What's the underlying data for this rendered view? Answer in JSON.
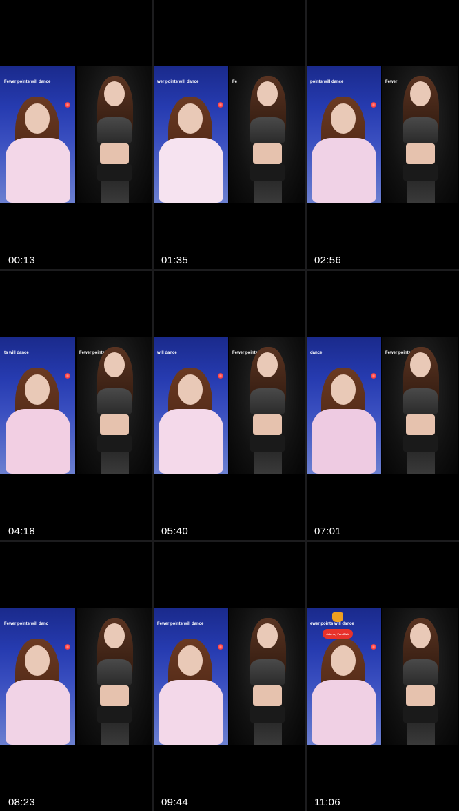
{
  "grid": {
    "thumbnails": [
      {
        "timestamp": "00:13",
        "caption": "Fewer points will dance",
        "caption2": ""
      },
      {
        "timestamp": "01:35",
        "caption": "wer points will dance",
        "caption2": "Fe"
      },
      {
        "timestamp": "02:56",
        "caption": "points will dance",
        "caption2": "Fewer"
      },
      {
        "timestamp": "04:18",
        "caption": "ts will dance",
        "caption2": "Fewer points"
      },
      {
        "timestamp": "05:40",
        "caption": "will dance",
        "caption2": "Fewer points v"
      },
      {
        "timestamp": "07:01",
        "caption": "dance",
        "caption2": "Fewer points will c"
      },
      {
        "timestamp": "08:23",
        "caption": "Fewer points will danc",
        "caption2": ""
      },
      {
        "timestamp": "09:44",
        "caption": "Fewer points will dance",
        "caption2": ""
      },
      {
        "timestamp": "11:06",
        "caption": "ewer points will dance",
        "caption2": "",
        "badge": "Join my Fan Club"
      }
    ]
  },
  "colors": {
    "background": "#000000",
    "separator": "#1c1c1e",
    "stage_blue": "#263bb0",
    "dark_stage": "#111111",
    "timestamp_text": "#ffffff"
  }
}
